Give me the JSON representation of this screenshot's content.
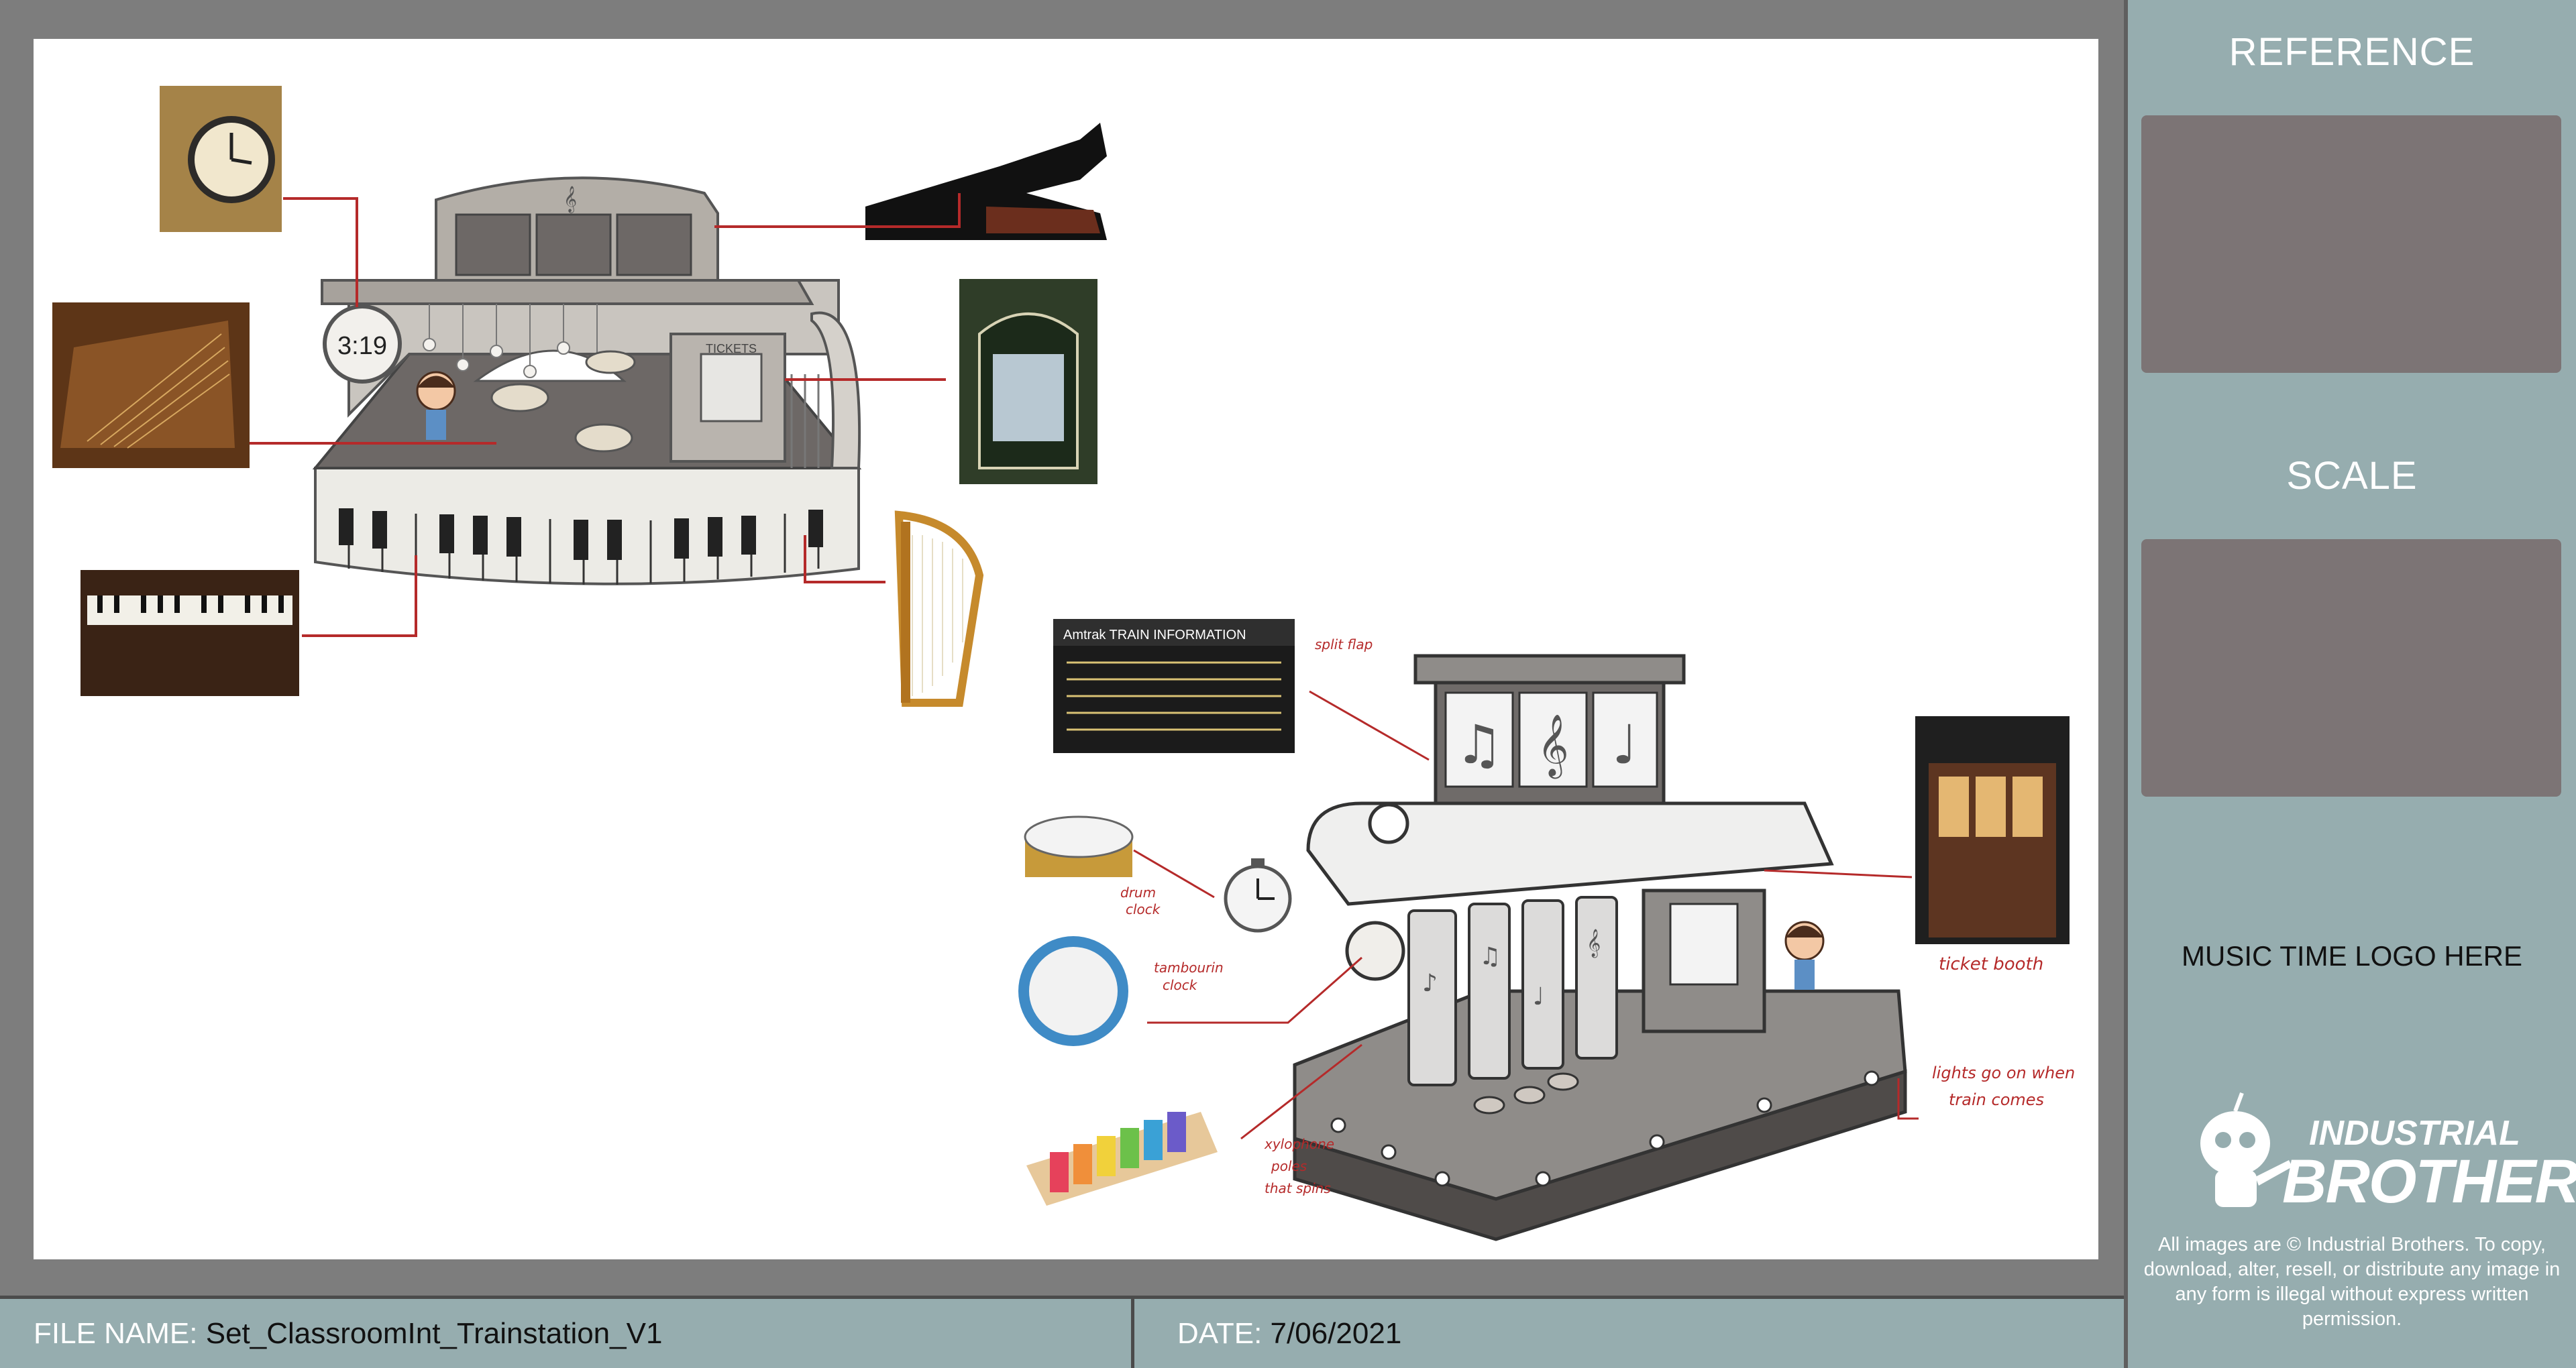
{
  "sidebar": {
    "reference_title": "REFERENCE",
    "scale_title": "SCALE",
    "logo_placeholder": "MUSIC TIME LOGO HERE",
    "brand_line1": "INDUSTRIAL",
    "brand_line2": "BROTHERS",
    "copyright": "All images are © Industrial Brothers. To copy, download, alter, resell, or distribute any image in any form is illegal without express written permission."
  },
  "footer": {
    "file_label": "FILE NAME:",
    "file_name": "Set_ClassroomInt_Trainstation_V1",
    "date_label": "DATE:",
    "date_value": "7/06/2021"
  },
  "canvas": {
    "top_set": {
      "clock_face_text": "3:19",
      "ticket_sign": "TICKETS"
    },
    "bottom_set": {
      "board_caption": "Amtrak TRAIN INFORMATION",
      "notes": {
        "split_flap": "split flap",
        "drum_clock_1": "drum",
        "drum_clock_2": "clock",
        "tambourine_1": "tambourin",
        "tambourine_2": "clock",
        "xylophone_1": "xylophone",
        "xylophone_2": "poles",
        "xylophone_3": "that spins",
        "ticket_booth": "ticket booth",
        "lights_1": "lights go on when",
        "lights_2": "train comes"
      }
    }
  },
  "colors": {
    "frame": "#7d7d7d",
    "sidebar": "#96adaf",
    "placeholder_box": "#7c7475",
    "callout_red": "#b52a2a"
  }
}
